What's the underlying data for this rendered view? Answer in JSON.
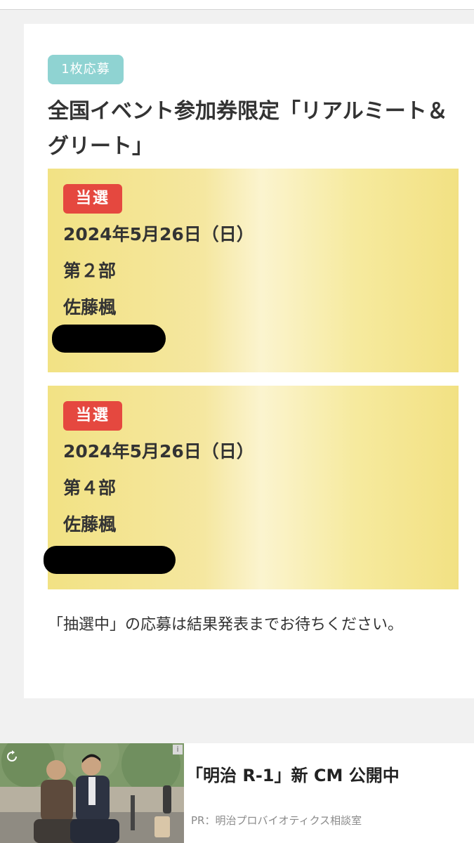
{
  "entry": {
    "quantity_badge": "1枚応募",
    "title": "全国イベント参加券限定「リアルミート＆グリート」",
    "tickets": [
      {
        "status": "当選",
        "date": "2024年5月26日（日）",
        "part": "第２部",
        "member": "佐藤楓"
      },
      {
        "status": "当選",
        "date": "2024年5月26日（日）",
        "part": "第４部",
        "member": "佐藤楓"
      }
    ],
    "notice": "「抽選中」の応募は結果発表までお待ちください。"
  },
  "ad": {
    "headline": "「明治 R-1」新 CM 公開中",
    "sponsor": "PR：明治プロバイオティクス相談室",
    "info_icon": "info-icon",
    "replay_icon": "replay-icon"
  },
  "colors": {
    "quantity_badge": "#8fd3d2",
    "won_badge": "#e5483f",
    "ticket_gold": "#f2e284"
  }
}
